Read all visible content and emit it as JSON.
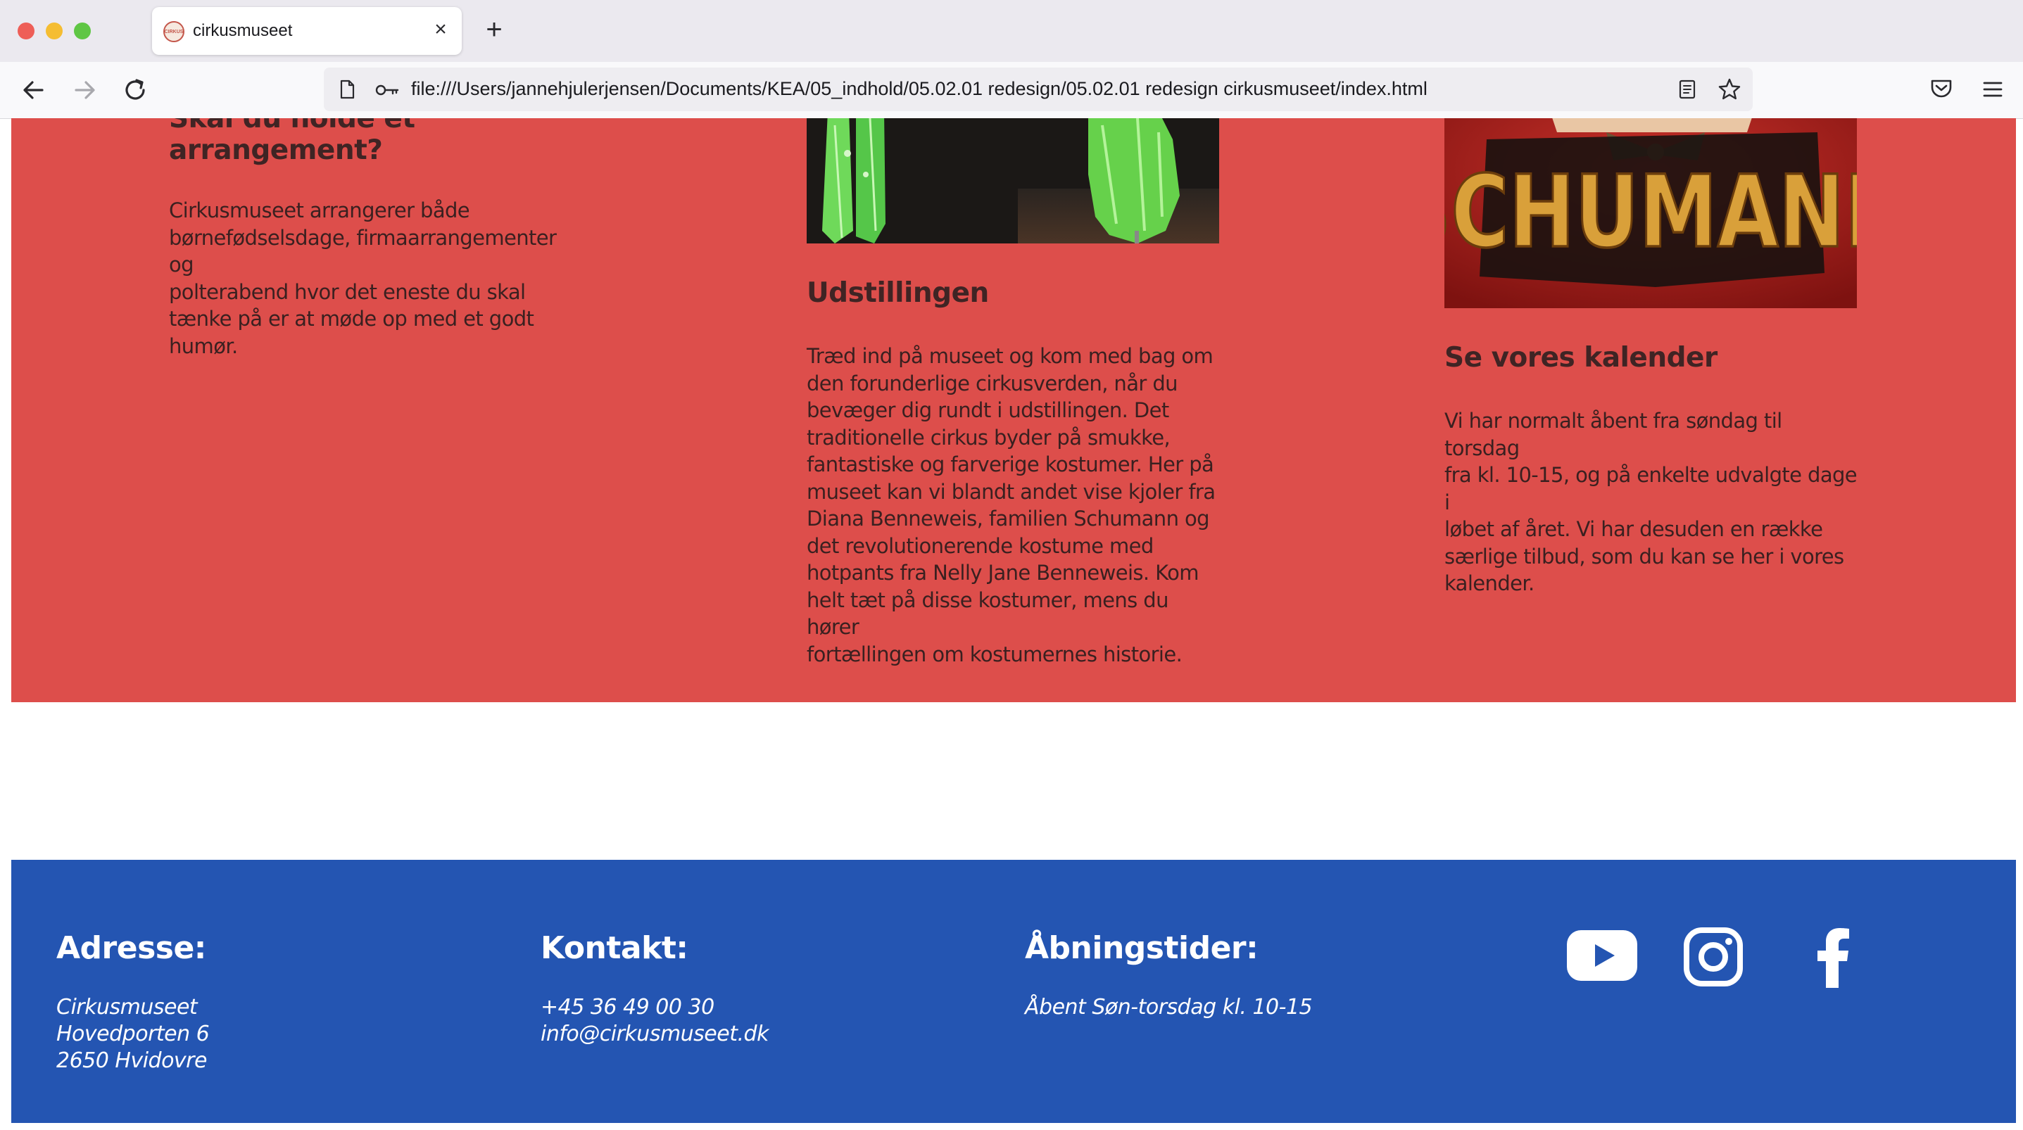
{
  "browser": {
    "tab_title": "cirkusmuseet",
    "tab_close": "×",
    "new_tab": "+",
    "favicon_text": "CIRKUS",
    "url": "file:///Users/jannehjulerjensen/Documents/KEA/05_indhold/05.02.01 redesign/05.02.01 redesign cirkusmuseet/index.html"
  },
  "content": {
    "col1": {
      "heading": "Skal du holde et arrangement?",
      "lines": [
        "Cirkusmuseet arrangerer både",
        "børnefødselsdage, firmaarrangementer og",
        "polterabend hvor det eneste du skal",
        "tænke på er at møde op med et godt",
        "humør."
      ]
    },
    "col2": {
      "heading": "Udstillingen",
      "lines": [
        "Træd ind på museet og kom med bag om",
        "den forunderlige cirkusverden, når du",
        "bevæger dig rundt i udstillingen. Det",
        "traditionelle cirkus byder på smukke,",
        "fantastiske og farverige kostumer. Her på",
        "museet kan vi blandt andet vise kjoler fra",
        "Diana Benneweis, familien Schumann og",
        "det revolutionerende kostume med",
        "hotpants fra Nelly Jane Benneweis. Kom",
        "helt tæt på disse kostumer, mens du hører",
        "fortællingen om kostumernes historie."
      ]
    },
    "col3": {
      "heading": "Se vores kalender",
      "image_text": "SCHUMANN",
      "lines": [
        "Vi har normalt åbent fra søndag til torsdag",
        "fra kl. 10-15, og på enkelte udvalgte dage i",
        "løbet af året. Vi har desuden en række",
        "særlige tilbud, som du kan se her i vores",
        "kalender."
      ]
    }
  },
  "footer": {
    "address": {
      "heading": "Adresse:",
      "lines": [
        "Cirkusmuseet",
        "Hovedporten 6",
        "2650 Hvidovre"
      ]
    },
    "contact": {
      "heading": "Kontakt:",
      "lines": [
        "+45 36 49 00 30",
        "info@cirkusmuseet.dk"
      ]
    },
    "hours": {
      "heading": "Åbningstider:",
      "lines": [
        "Åbent Søn-torsdag kl. 10-15"
      ]
    },
    "social_icons": [
      "youtube-icon",
      "instagram-icon",
      "facebook-icon"
    ]
  },
  "colors": {
    "section_red": "#dd4e4b",
    "footer_blue": "#2455b2",
    "text_dark": "#3a2020"
  }
}
